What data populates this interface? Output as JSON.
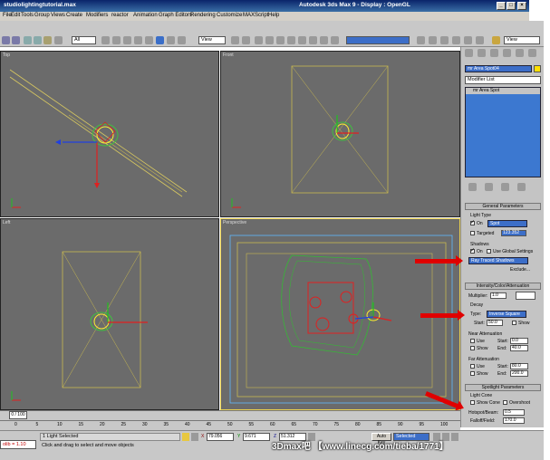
{
  "window": {
    "file_title": "studiolightingtutorial.max",
    "app_title": "Autodesk 3ds Max 9  - Display : OpenGL",
    "min": "_",
    "max": "□",
    "close": "×"
  },
  "menu": [
    "File",
    "Edit",
    "Tools",
    "Group",
    "Views",
    "Create",
    "Modifiers",
    "reactor",
    "Animation",
    "Graph Editors",
    "Rendering",
    "Customize",
    "MAXScript",
    "Help"
  ],
  "toolbar": {
    "selection_filter": "All",
    "ref_coord": "View",
    "named_sel": "",
    "view_dd": "View"
  },
  "viewports": {
    "top": "Top",
    "front": "Front",
    "left": "Left",
    "perspective": "Perspective"
  },
  "command_panel": {
    "object_name": "mr Area Spot04",
    "modifier_list": "Modifier List",
    "stack_item": "mr Area Spot",
    "general": {
      "header": "General Parameters",
      "light_type": "Light Type",
      "on_label": "On",
      "type_value": "Spot",
      "targeted_label": "Targeted",
      "targeted_value": "123.352",
      "shadows_label": "Shadows",
      "shadows_on": "On",
      "global_settings": "Use Global Settings",
      "shadow_type": "Ray Traced Shadows",
      "exclude": "Exclude..."
    },
    "intensity": {
      "header": "Intensity/Color/Attenuation",
      "multiplier_label": "Multiplier:",
      "multiplier": "1.0",
      "decay": "Decay",
      "type_label": "Type:",
      "type_value": "Inverse Square",
      "start_label": "Start:",
      "start_value": "50.0",
      "show": "Show",
      "near_atten": "Near Attenuation",
      "use": "Use",
      "near_start_label": "Start:",
      "near_start": "0.0",
      "near_end_label": "End:",
      "near_end": "40.0",
      "far_atten": "Far Attenuation",
      "far_start_label": "Start:",
      "far_start": "80.0",
      "far_end_label": "End:",
      "far_end": "200.0"
    },
    "spotlight": {
      "header": "Spotlight Parameters",
      "light_cone": "Light Cone",
      "show_cone": "Show Cone",
      "overshoot": "Overshoot",
      "hotspot_label": "Hotspot/Beam:",
      "hotspot": "0.5",
      "falloff_label": "Falloff/Field:",
      "falloff": "170.0"
    }
  },
  "timeline": {
    "frame": "0 / 100",
    "ticks": [
      "0",
      "5",
      "10",
      "15",
      "20",
      "25",
      "30",
      "35",
      "40",
      "45",
      "50",
      "55",
      "60",
      "65",
      "70",
      "75",
      "80",
      "85",
      "90",
      "95",
      "100"
    ]
  },
  "status": {
    "script_listener": "olib = 1.10",
    "selection": "1 Light Selected",
    "prompt": "Click and drag to select and move objects",
    "x": "79.056",
    "y": "9.671",
    "z": "51.312",
    "autokey": "Auto Key",
    "selected_dd": "Selected",
    "watermark": "3Dmax吧 【www.linecg.com/tieba/1771】"
  }
}
